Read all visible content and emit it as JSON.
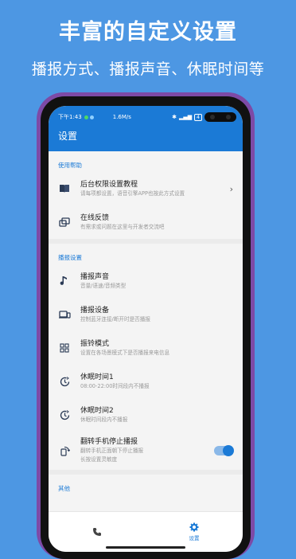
{
  "promo": {
    "title": "丰富的自定义设置",
    "subtitle": "播报方式、播报声音、休眠时间等"
  },
  "statusbar": {
    "time": "下午1:43",
    "network": "1.6M/s",
    "battery": "4"
  },
  "appbar": {
    "title": "设置"
  },
  "sections": {
    "help": {
      "header": "使用帮助",
      "items": [
        {
          "title": "后台权限设置教程",
          "desc": "请每项都设置，语音引擎APP也按此方式设置"
        },
        {
          "title": "在线反馈",
          "desc": "有需求或问题在这里与开发者交流吧"
        }
      ]
    },
    "broadcast": {
      "header": "播报设置",
      "items": [
        {
          "title": "播报声音",
          "desc": "音量/语速/音频类型"
        },
        {
          "title": "播报设备",
          "desc": "控制蓝牙连接/断开时是否播报"
        },
        {
          "title": "振铃模式",
          "desc": "设置在各场景模式下是否播报来电信息"
        },
        {
          "title": "休眠时间1",
          "desc": "08:00-22:00时间段内不播报"
        },
        {
          "title": "休眠时间2",
          "desc": "休眠时间段内不播报"
        },
        {
          "title": "翻转手机停止播报",
          "desc": "翻转手机正面朝下停止播报",
          "desc2": "长按设置灵敏度",
          "toggle_on": true
        }
      ]
    },
    "other": {
      "header": "其他"
    }
  },
  "bottom_nav": {
    "settings_label": "设置"
  },
  "colors": {
    "background": "#4d97e3",
    "accent": "#1b7ad6",
    "phone_frame": "#7d4aa6"
  }
}
